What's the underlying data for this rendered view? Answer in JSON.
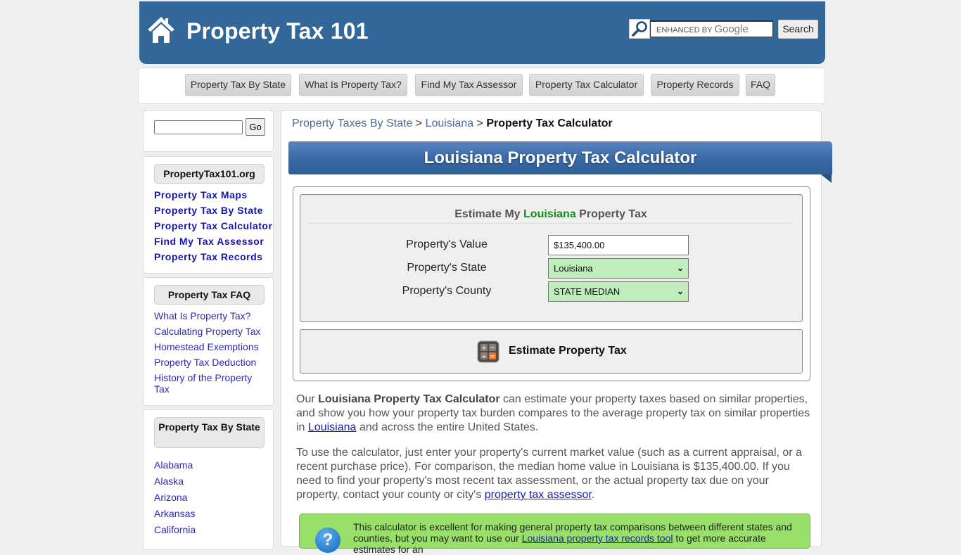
{
  "header": {
    "site_title": "Property Tax 101",
    "search_placeholder_prefix": "ENHANCED BY",
    "search_placeholder_brand": "Google",
    "search_button": "Search"
  },
  "nav": {
    "items": [
      {
        "label": "Property Tax By State"
      },
      {
        "label": "What Is Property Tax?"
      },
      {
        "label": "Find My Tax Assessor"
      },
      {
        "label": "Property Tax Calculator"
      },
      {
        "label": "Property Records"
      },
      {
        "label": "FAQ"
      }
    ]
  },
  "sidebar": {
    "search_value": "",
    "go_label": "Go",
    "site_box": {
      "heading": "PropertyTax101.org",
      "links": [
        "Property Tax Maps",
        "Property Tax By State",
        "Property Tax Calculator",
        "Find My Tax Assessor",
        "Property Tax Records"
      ]
    },
    "faq_box": {
      "heading": "Property Tax FAQ",
      "links": [
        "What Is Property Tax?",
        "Calculating Property Tax",
        "Homestead Exemptions",
        "Property Tax Deduction",
        "History of the Property Tax"
      ]
    },
    "state_box": {
      "heading": "Property Tax By State",
      "links": [
        "Alabama",
        "Alaska",
        "Arizona",
        "Arkansas",
        "California"
      ]
    }
  },
  "breadcrumb": {
    "items": [
      "Property Taxes By State",
      "Louisiana"
    ],
    "separator": ">",
    "current": "Property Tax Calculator"
  },
  "page_title": "Louisiana Property Tax Calculator",
  "calculator": {
    "title_prefix": "Estimate My",
    "title_state": "Louisiana",
    "title_suffix": "Property Tax",
    "value_label": "Property's Value",
    "value": "$135,400.00",
    "state_label": "Property's State",
    "state_selected": "Louisiana",
    "county_label": "Property's County",
    "county_selected": "STATE MEDIAN",
    "estimate_button": "Estimate Property Tax"
  },
  "content": {
    "p1_prefix": "Our",
    "p1_bold": "Louisiana Property Tax Calculator",
    "p1_mid": "can estimate your property taxes based on similar properties, and show you how your property tax burden compares to the average property tax on similar properties in",
    "p1_link": "Louisiana",
    "p1_suffix": "and across the entire United States.",
    "p2_text": "To use the calculator, just enter your property's current market value (such as a current appraisal, or a recent purchase price). For comparison, the median home value in Louisiana is $135,400.00. If you need to find your property's most recent tax assessment, or the actual property tax due on your property, contact your county or city's",
    "p2_link": "property tax assessor",
    "p2_end": ".",
    "tip_prefix": "This calculator is excellent for making general property tax comparisons between different states and counties, but you may want to use our",
    "tip_link": "Louisiana property tax records tool",
    "tip_suffix": "to get more accurate estimates for an",
    "tip_icon": "?"
  },
  "colors": {
    "brand_blue": "#336699",
    "state_green": "#1a8a1a",
    "select_bg": "#bfedbb",
    "tip_bg": "#99e06b"
  }
}
